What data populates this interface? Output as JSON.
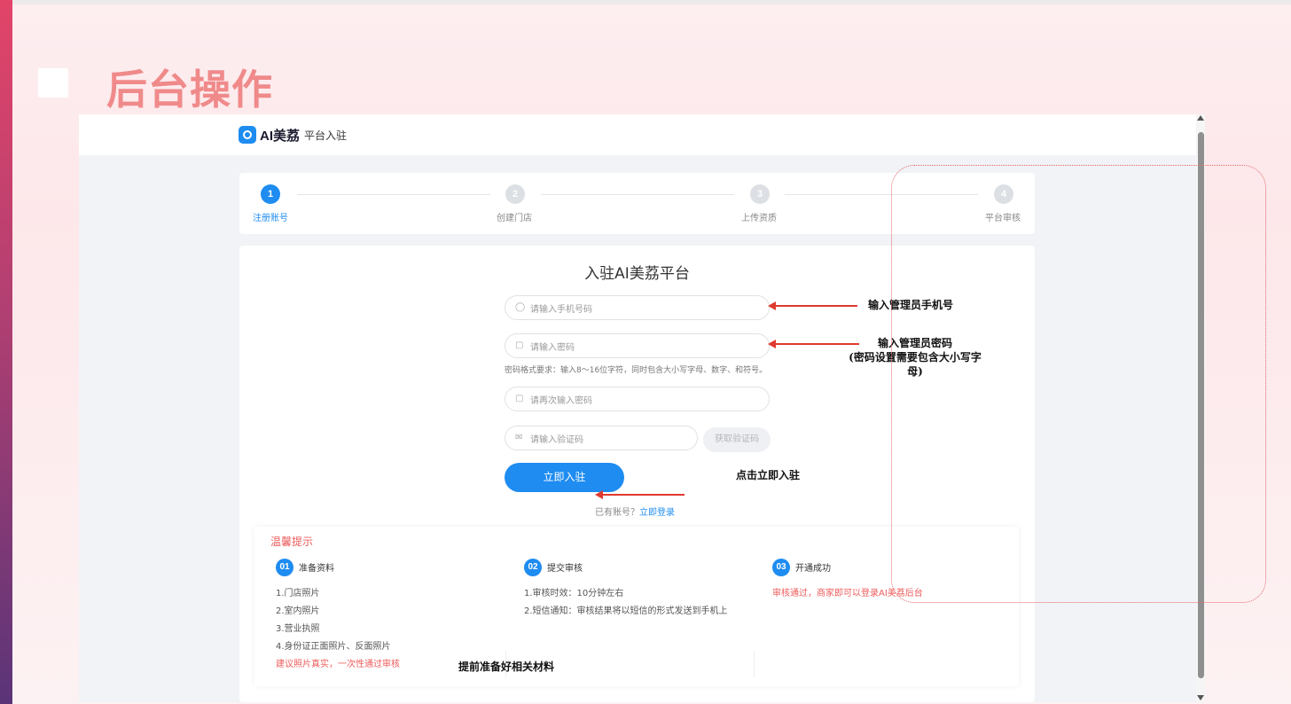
{
  "slide": {
    "title": "后台操作"
  },
  "app": {
    "logo_text": "AI美荔",
    "logo_sub": "平台入驻",
    "steps": [
      {
        "num": "1",
        "label": "注册账号",
        "active": true
      },
      {
        "num": "2",
        "label": "创建门店",
        "active": false
      },
      {
        "num": "3",
        "label": "上传资质",
        "active": false
      },
      {
        "num": "4",
        "label": "平台审核",
        "active": false
      }
    ],
    "form": {
      "title": "入驻AI美荔平台",
      "phone_placeholder": "请输入手机号码",
      "password_placeholder": "请输入密码",
      "password_hint": "密码格式要求：输入8～16位字符，同时包含大小写字母、数字、和符号。",
      "confirm_placeholder": "请再次输入密码",
      "code_placeholder": "请输入验证码",
      "code_button": "获取验证码",
      "submit": "立即入驻",
      "have_account": "已有账号？",
      "login_link": "立即登录"
    },
    "tips": {
      "title": "温馨提示",
      "columns": [
        {
          "num": "01",
          "head": "准备资料",
          "lines": [
            "1.门店照片",
            "2.室内照片",
            "3.营业执照",
            "4.身份证正面照片、反面照片"
          ],
          "note": "建议照片真实，一次性通过审核"
        },
        {
          "num": "02",
          "head": "提交审核",
          "lines": [
            "1.审核时效：10分钟左右",
            "2.短信通知：审核结果将以短信的形式发送到手机上"
          ]
        },
        {
          "num": "03",
          "head": "开通成功",
          "note": "审核通过，商家即可以登录AI美荔后台"
        }
      ]
    }
  },
  "annotations": {
    "phone": "输入管理员手机号",
    "password_line1": "输入管理员密码",
    "password_line2": "(密码设置需要包含大小写字",
    "password_line3": "母)",
    "submit": "点击立即入驻",
    "prepare": "提前准备好相关材料"
  },
  "colors": {
    "accent": "#1e8cf0",
    "warning": "#ee5b5b",
    "title": "#f08a8a",
    "annotation_arrow": "#e03a2f"
  }
}
